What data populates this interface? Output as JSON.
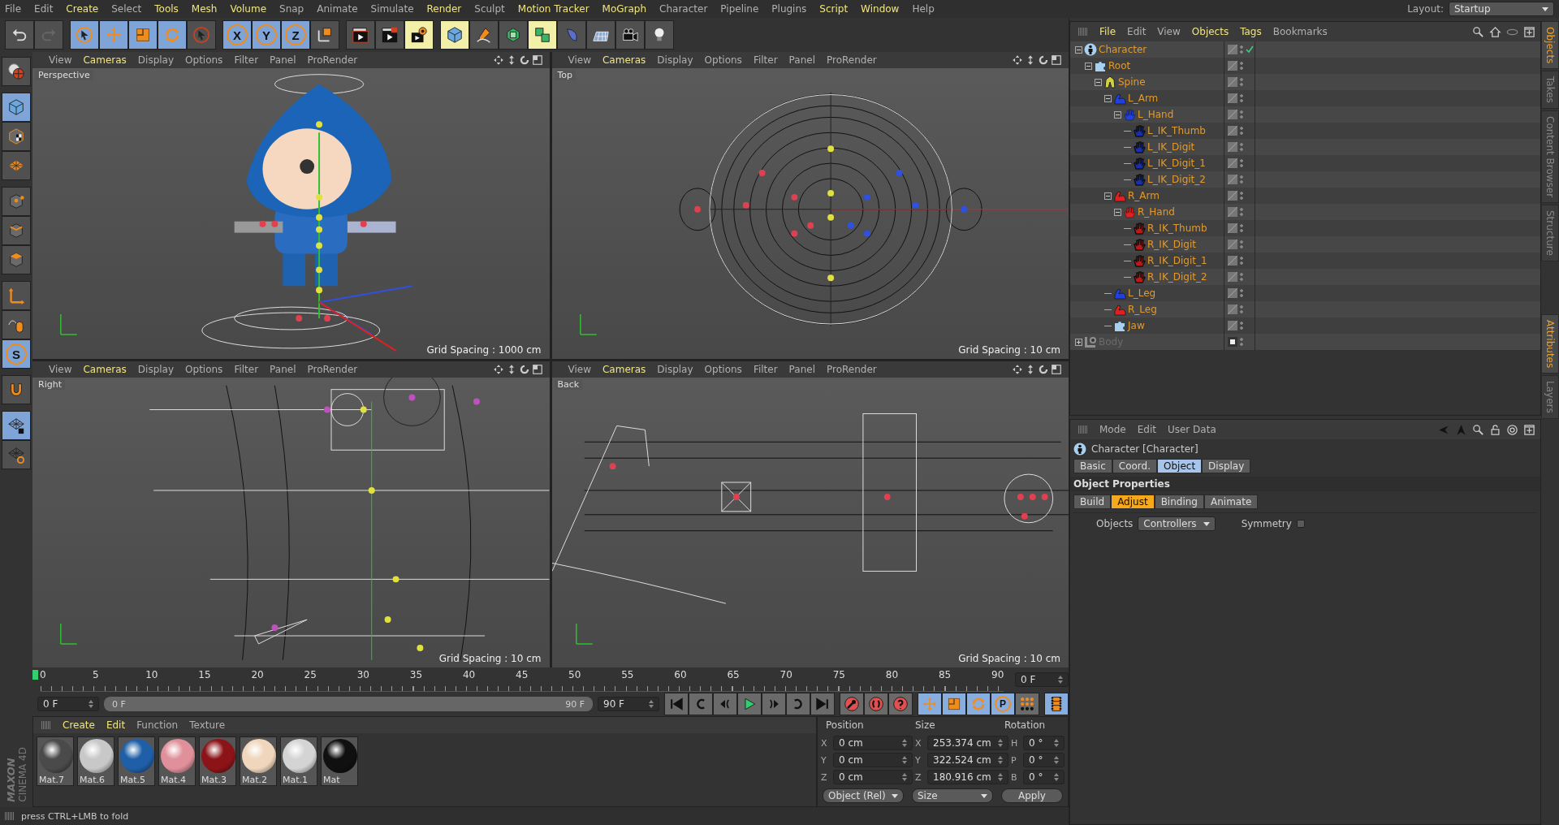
{
  "menu": [
    {
      "label": "File",
      "accent": false
    },
    {
      "label": "Edit",
      "accent": false
    },
    {
      "label": "Create",
      "accent": true
    },
    {
      "label": "Select",
      "accent": false
    },
    {
      "label": "Tools",
      "accent": true
    },
    {
      "label": "Mesh",
      "accent": true
    },
    {
      "label": "Volume",
      "accent": true
    },
    {
      "label": "Snap",
      "accent": false
    },
    {
      "label": "Animate",
      "accent": false
    },
    {
      "label": "Simulate",
      "accent": false
    },
    {
      "label": "Render",
      "accent": true
    },
    {
      "label": "Sculpt",
      "accent": false
    },
    {
      "label": "Motion Tracker",
      "accent": true
    },
    {
      "label": "MoGraph",
      "accent": true
    },
    {
      "label": "Character",
      "accent": false
    },
    {
      "label": "Pipeline",
      "accent": false
    },
    {
      "label": "Plugins",
      "accent": false
    },
    {
      "label": "Script",
      "accent": true
    },
    {
      "label": "Window",
      "accent": true
    },
    {
      "label": "Help",
      "accent": false
    }
  ],
  "layout": {
    "label": "Layout:",
    "value": "Startup"
  },
  "toolbar": [
    [
      {
        "kind": "undo",
        "selected": false
      },
      {
        "kind": "redo",
        "selected": false
      }
    ],
    [
      {
        "kind": "select",
        "selected": true
      },
      {
        "kind": "move",
        "selected": true
      },
      {
        "kind": "scale",
        "selected": true
      },
      {
        "kind": "rotate",
        "selected": true
      },
      {
        "kind": "live",
        "selected": false
      }
    ],
    [
      {
        "kind": "letter",
        "glyph": "X",
        "selected": true
      },
      {
        "kind": "letter",
        "glyph": "Y",
        "selected": true
      },
      {
        "kind": "letter",
        "glyph": "Z",
        "selected": true
      },
      {
        "kind": "coord",
        "selected": false
      }
    ],
    [
      {
        "kind": "render-view",
        "selected": false
      },
      {
        "kind": "render-picture",
        "selected": false
      },
      {
        "kind": "render-settings",
        "selected": true
      }
    ],
    [
      {
        "kind": "cube",
        "selected": true
      },
      {
        "kind": "pen",
        "selected": false
      },
      {
        "kind": "subdivide",
        "selected": false
      },
      {
        "kind": "array",
        "selected": true
      },
      {
        "kind": "deformer",
        "selected": false
      },
      {
        "kind": "floor",
        "selected": false
      },
      {
        "kind": "camera",
        "selected": false
      },
      {
        "kind": "light",
        "selected": false
      }
    ]
  ],
  "left_tools": [
    [
      {
        "kind": "globe",
        "selected": false
      }
    ],
    [
      {
        "kind": "model",
        "selected": true
      },
      {
        "kind": "texture",
        "selected": false
      },
      {
        "kind": "workplane",
        "selected": false
      }
    ],
    [
      {
        "kind": "points",
        "selected": false
      },
      {
        "kind": "edges",
        "selected": false
      },
      {
        "kind": "polygons",
        "selected": false
      }
    ],
    [
      {
        "kind": "axis",
        "selected": false
      },
      {
        "kind": "mouse",
        "selected": false
      },
      {
        "kind": "letter",
        "glyph": "S",
        "selected": true
      }
    ],
    [
      {
        "kind": "magnet",
        "selected": false
      }
    ],
    [
      {
        "kind": "grid-lock",
        "selected": true
      },
      {
        "kind": "grid-cycle",
        "selected": false
      }
    ]
  ],
  "viewports": [
    {
      "kind": "perspective",
      "label": "Perspective",
      "grid_spacing": "Grid Spacing : 1000 cm",
      "menu": [
        {
          "label": "View",
          "accent": false
        },
        {
          "label": "Cameras",
          "accent": true
        },
        {
          "label": "Display",
          "accent": false
        },
        {
          "label": "Options",
          "accent": false
        },
        {
          "label": "Filter",
          "accent": false
        },
        {
          "label": "Panel",
          "accent": false
        },
        {
          "label": "ProRender",
          "accent": false
        }
      ]
    },
    {
      "kind": "top",
      "label": "Top",
      "grid_spacing": "Grid Spacing : 10 cm",
      "menu": [
        {
          "label": "View",
          "accent": false
        },
        {
          "label": "Cameras",
          "accent": true
        },
        {
          "label": "Display",
          "accent": false
        },
        {
          "label": "Options",
          "accent": false
        },
        {
          "label": "Filter",
          "accent": false
        },
        {
          "label": "Panel",
          "accent": false
        },
        {
          "label": "ProRender",
          "accent": false
        }
      ]
    },
    {
      "kind": "right",
      "label": "Right",
      "grid_spacing": "Grid Spacing : 10 cm",
      "menu": [
        {
          "label": "View",
          "accent": false
        },
        {
          "label": "Cameras",
          "accent": true
        },
        {
          "label": "Display",
          "accent": false
        },
        {
          "label": "Options",
          "accent": false
        },
        {
          "label": "Filter",
          "accent": false
        },
        {
          "label": "Panel",
          "accent": false
        },
        {
          "label": "ProRender",
          "accent": false
        }
      ]
    },
    {
      "kind": "back",
      "label": "Back",
      "grid_spacing": "Grid Spacing : 10 cm",
      "menu": [
        {
          "label": "View",
          "accent": false
        },
        {
          "label": "Cameras",
          "accent": true
        },
        {
          "label": "Display",
          "accent": false
        },
        {
          "label": "Options",
          "accent": false
        },
        {
          "label": "Filter",
          "accent": false
        },
        {
          "label": "Panel",
          "accent": false
        },
        {
          "label": "ProRender",
          "accent": false
        }
      ]
    }
  ],
  "timeline": {
    "ticks": [
      "0",
      "5",
      "10",
      "15",
      "20",
      "25",
      "30",
      "35",
      "40",
      "45",
      "50",
      "55",
      "60",
      "65",
      "70",
      "75",
      "80",
      "85",
      "90"
    ],
    "current_frame": "0 F",
    "start": "0 F",
    "range_start": "0 F",
    "range_end": "90 F",
    "range": {
      "level": 1
    },
    "end": "90 F",
    "transport": [
      {
        "kind": "to-start"
      },
      {
        "kind": "prev-key"
      },
      {
        "kind": "prev-frame"
      },
      {
        "kind": "play"
      },
      {
        "kind": "next-frame"
      },
      {
        "kind": "next-key"
      },
      {
        "kind": "to-end"
      }
    ],
    "keys": [
      {
        "kind": "record"
      },
      {
        "kind": "autokey"
      },
      {
        "kind": "keyset"
      }
    ],
    "modes": [
      {
        "kind": "move",
        "selected": true
      },
      {
        "kind": "scale",
        "selected": true
      },
      {
        "kind": "rotate",
        "selected": true
      },
      {
        "kind": "letter",
        "glyph": "P",
        "selected": true
      },
      {
        "kind": "dots",
        "selected": false
      }
    ],
    "film": {
      "selected": true
    }
  },
  "materials": {
    "menu": [
      {
        "label": "Create",
        "accent": true
      },
      {
        "label": "Edit",
        "accent": true
      },
      {
        "label": "Function",
        "accent": false
      },
      {
        "label": "Texture",
        "accent": false
      }
    ],
    "items": [
      {
        "name": "Mat.7",
        "color": "#4a4a4a"
      },
      {
        "name": "Mat.6",
        "color": "#c8c8c8"
      },
      {
        "name": "Mat.5",
        "color": "#1f5fa8"
      },
      {
        "name": "Mat.4",
        "color": "#e0909a"
      },
      {
        "name": "Mat.3",
        "color": "#8c1418"
      },
      {
        "name": "Mat.2",
        "color": "#f0d6bc"
      },
      {
        "name": "Mat.1",
        "color": "#d4d4d4"
      },
      {
        "name": "Mat",
        "color": "#101010"
      }
    ]
  },
  "coordinates": {
    "headers": [
      "Position",
      "Size",
      "Rotation"
    ],
    "rows": [
      {
        "pos_axis": "X",
        "position": "0 cm",
        "size_axis": "X",
        "size": "253.374 cm",
        "rot_axis": "H",
        "rotation": "0 °"
      },
      {
        "pos_axis": "Y",
        "position": "0 cm",
        "size_axis": "Y",
        "size": "322.524 cm",
        "rot_axis": "P",
        "rotation": "0 °"
      },
      {
        "pos_axis": "Z",
        "position": "0 cm",
        "size_axis": "Z",
        "size": "180.916 cm",
        "rot_axis": "B",
        "rotation": "0 °"
      }
    ],
    "space": "Object (Rel)",
    "mode": "Size",
    "apply": "Apply"
  },
  "brand": [
    "MAXON",
    "CINEMA 4D"
  ],
  "status_bar": "press CTRL+LMB to fold",
  "object_manager": {
    "menu": [
      {
        "label": "File",
        "accent": true
      },
      {
        "label": "Edit",
        "accent": false
      },
      {
        "label": "View",
        "accent": false
      },
      {
        "label": "Objects",
        "accent": true
      },
      {
        "label": "Tags",
        "accent": true
      },
      {
        "label": "Bookmarks",
        "accent": false
      }
    ],
    "tree": [
      {
        "name": "Character",
        "kind": "figure",
        "color": "#a8d0f0",
        "expanded": true,
        "checked": true,
        "disabled": false,
        "children": [
          {
            "name": "Root",
            "kind": "puzzle",
            "color": "#a8d0f0",
            "expanded": true,
            "checked": false,
            "disabled": false,
            "children": [
              {
                "name": "Spine",
                "kind": "spine",
                "color": "#d0d040",
                "expanded": true,
                "checked": false,
                "disabled": false,
                "children": [
                  {
                    "name": "L_Arm",
                    "kind": "arm",
                    "color": "#2040e0",
                    "expanded": true,
                    "checked": false,
                    "disabled": false,
                    "children": [
                      {
                        "name": "L_Hand",
                        "kind": "hand",
                        "color": "#2040e0",
                        "expanded": true,
                        "checked": false,
                        "disabled": false,
                        "children": [
                          {
                            "name": "L_IK_Thumb",
                            "kind": "ik-hand",
                            "color": "#1830b0",
                            "checked": false,
                            "disabled": false
                          },
                          {
                            "name": "L_IK_Digit",
                            "kind": "ik-hand",
                            "color": "#1830b0",
                            "checked": false,
                            "disabled": false
                          },
                          {
                            "name": "L_IK_Digit_1",
                            "kind": "ik-hand",
                            "color": "#1830b0",
                            "checked": false,
                            "disabled": false
                          },
                          {
                            "name": "L_IK_Digit_2",
                            "kind": "ik-hand",
                            "color": "#1830b0",
                            "checked": false,
                            "disabled": false
                          }
                        ]
                      }
                    ]
                  },
                  {
                    "name": "R_Arm",
                    "kind": "arm",
                    "color": "#e02020",
                    "expanded": true,
                    "checked": false,
                    "disabled": false,
                    "children": [
                      {
                        "name": "R_Hand",
                        "kind": "hand",
                        "color": "#e02020",
                        "expanded": true,
                        "checked": false,
                        "disabled": false,
                        "children": [
                          {
                            "name": "R_IK_Thumb",
                            "kind": "ik-hand",
                            "color": "#c01818",
                            "checked": false,
                            "disabled": false
                          },
                          {
                            "name": "R_IK_Digit",
                            "kind": "ik-hand",
                            "color": "#c01818",
                            "checked": false,
                            "disabled": false
                          },
                          {
                            "name": "R_IK_Digit_1",
                            "kind": "ik-hand",
                            "color": "#c01818",
                            "checked": false,
                            "disabled": false
                          },
                          {
                            "name": "R_IK_Digit_2",
                            "kind": "ik-hand",
                            "color": "#c01818",
                            "checked": false,
                            "disabled": false
                          }
                        ]
                      }
                    ]
                  },
                  {
                    "name": "L_Leg",
                    "kind": "arm",
                    "color": "#2040e0",
                    "checked": false,
                    "disabled": false
                  },
                  {
                    "name": "R_Leg",
                    "kind": "arm",
                    "color": "#e02020",
                    "checked": false,
                    "disabled": false
                  },
                  {
                    "name": "Jaw",
                    "kind": "puzzle",
                    "color": "#a8d0f0",
                    "checked": false,
                    "disabled": false
                  }
                ]
              }
            ]
          }
        ]
      },
      {
        "name": "Body",
        "kind": "null",
        "color": "#909090",
        "expanded": false,
        "checked": false,
        "disabled": true
      }
    ]
  },
  "attributes": {
    "menu": [
      {
        "label": "Mode",
        "accent": false
      },
      {
        "label": "Edit",
        "accent": false
      },
      {
        "label": "User Data",
        "accent": false
      }
    ],
    "title": "Character [Character]",
    "tabs": [
      {
        "label": "Basic",
        "selected": false
      },
      {
        "label": "Coord.",
        "selected": false
      },
      {
        "label": "Object",
        "selected": true
      },
      {
        "label": "Display",
        "selected": false
      }
    ],
    "section": "Object Properties",
    "subtabs": [
      {
        "label": "Build",
        "selected": false
      },
      {
        "label": "Adjust",
        "selected": true
      },
      {
        "label": "Binding",
        "selected": false
      },
      {
        "label": "Animate",
        "selected": false
      }
    ],
    "objects_label": "Objects",
    "objects_value": "Controllers",
    "symmetry_label": "Symmetry",
    "symmetry": false
  },
  "side_tabs_top": [
    {
      "label": "Objects",
      "selected": true
    },
    {
      "label": "Takes",
      "selected": false
    },
    {
      "label": "Content Browser",
      "selected": false
    },
    {
      "label": "Structure",
      "selected": false
    }
  ],
  "side_tabs_bottom": [
    {
      "label": "Attributes",
      "selected": true
    },
    {
      "label": "Layers",
      "selected": false
    }
  ]
}
